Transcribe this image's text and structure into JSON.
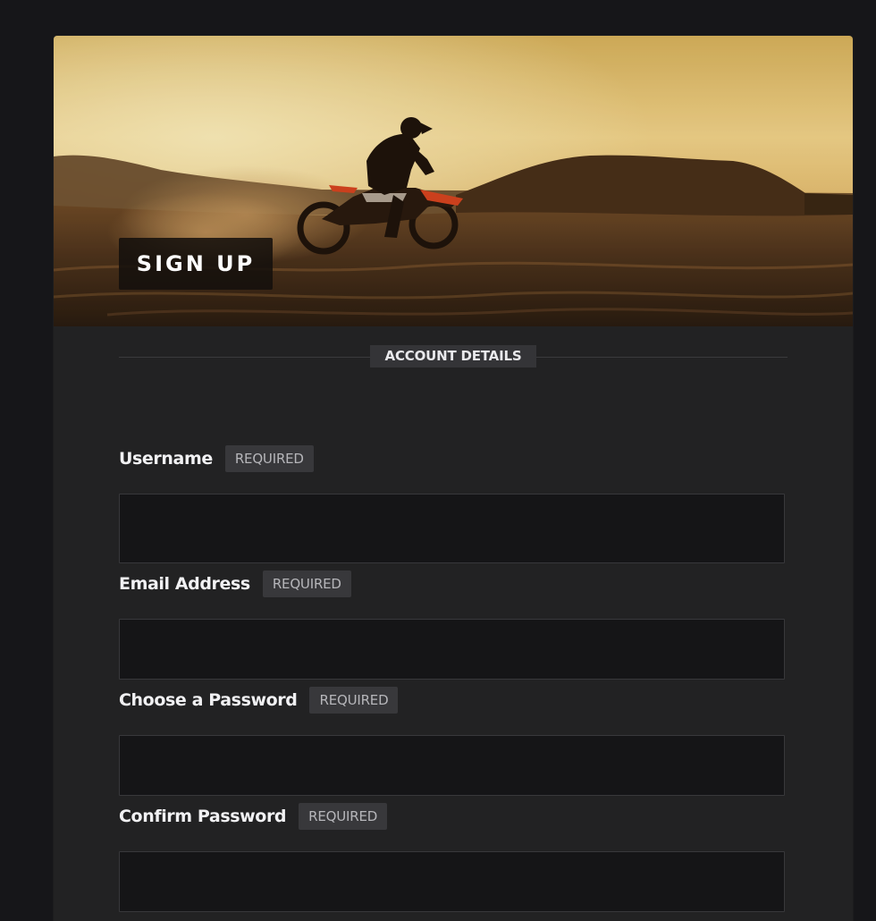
{
  "hero": {
    "title": "SIGN UP",
    "image": "motocross-rider-sunset"
  },
  "section": {
    "title": "ACCOUNT DETAILS"
  },
  "fields": [
    {
      "label": "Username",
      "badge": "REQUIRED",
      "value": "",
      "placeholder": ""
    },
    {
      "label": "Email Address",
      "badge": "REQUIRED",
      "value": "",
      "placeholder": ""
    },
    {
      "label": "Choose a Password",
      "badge": "REQUIRED",
      "value": "",
      "placeholder": ""
    },
    {
      "label": "Confirm Password",
      "badge": "REQUIRED",
      "value": "",
      "placeholder": ""
    }
  ],
  "colors": {
    "page_background": "#161619",
    "card_background": "#222223",
    "input_background": "#151517",
    "badge_background": "#38383b",
    "sky_glow": "#f2cf7a",
    "bike_accent": "#d8451f"
  }
}
